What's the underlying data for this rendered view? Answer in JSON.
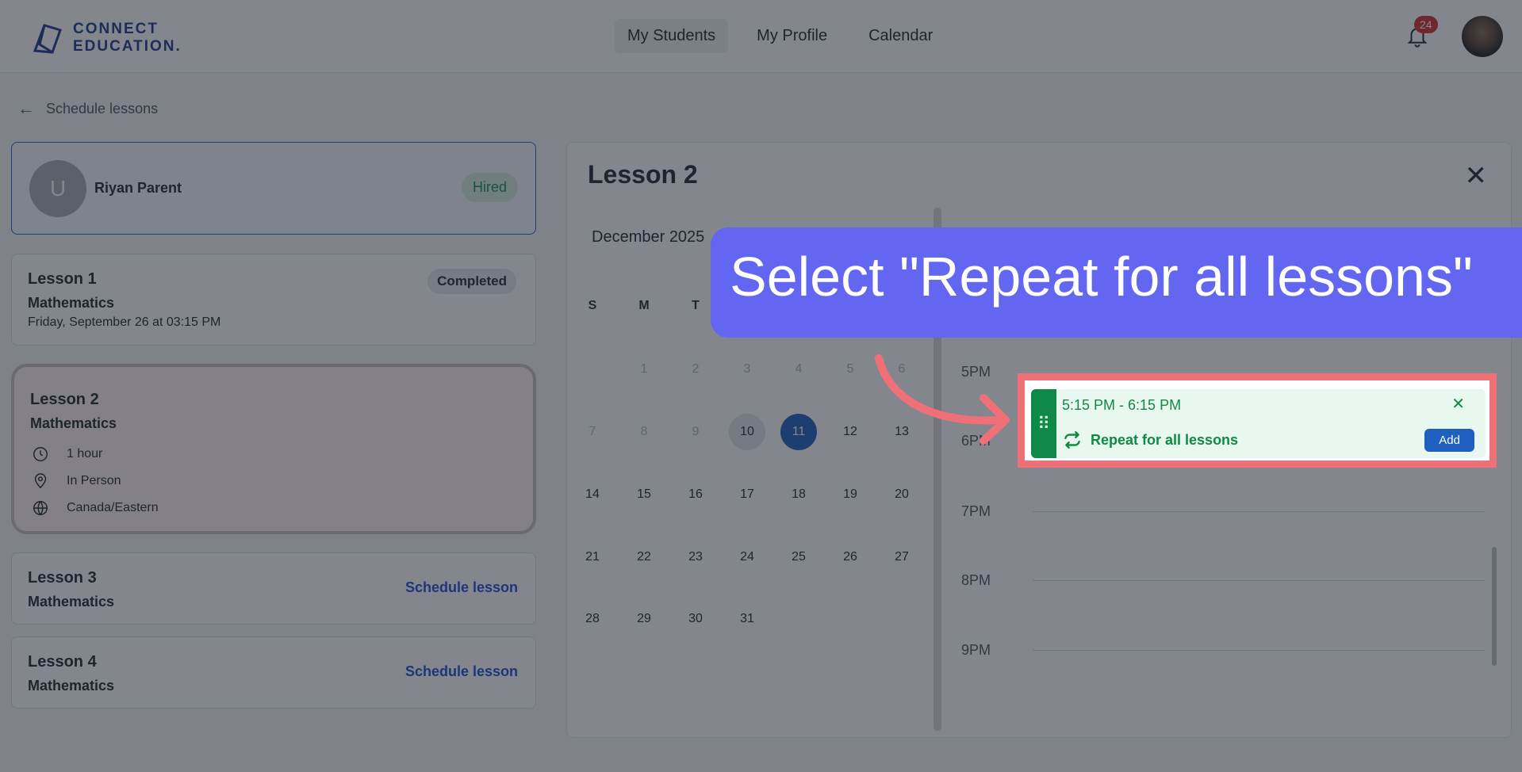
{
  "header": {
    "logo_line1": "CONNECT",
    "logo_line2": "EDUCATION.",
    "nav": [
      "My Students",
      "My Profile",
      "Calendar"
    ],
    "notification_count": "24"
  },
  "breadcrumb": {
    "back_label": "Schedule lessons"
  },
  "student": {
    "initial": "U",
    "name": "Riyan Parent",
    "status": "Hired"
  },
  "lessons": [
    {
      "title": "Lesson 1",
      "subject": "Mathematics",
      "date": "Friday, September 26 at 03:15 PM",
      "status": "Completed"
    },
    {
      "title": "Lesson 2",
      "subject": "Mathematics",
      "duration": "1 hour",
      "location": "In Person",
      "timezone": "Canada/Eastern"
    },
    {
      "title": "Lesson 3",
      "subject": "Mathematics",
      "action": "Schedule lesson"
    },
    {
      "title": "Lesson 4",
      "subject": "Mathematics",
      "action": "Schedule lesson"
    }
  ],
  "panel": {
    "title": "Lesson 2",
    "month": "December 2025",
    "weekdays": [
      "S",
      "M",
      "T"
    ],
    "calendar_days": [
      "1",
      "2",
      "3",
      "4",
      "5",
      "6",
      "7",
      "8",
      "9",
      "10",
      "11",
      "12",
      "13",
      "14",
      "15",
      "16",
      "17",
      "18",
      "19",
      "20",
      "21",
      "22",
      "23",
      "24",
      "25",
      "26",
      "27",
      "28",
      "29",
      "30",
      "31"
    ],
    "today": "10",
    "selected": "11",
    "time_labels": [
      "5PM",
      "6PM",
      "7PM",
      "8PM",
      "9PM"
    ]
  },
  "slot": {
    "time_range": "5:15 PM - 6:15 PM",
    "repeat_label": "Repeat for all lessons",
    "add_label": "Add",
    "close_symbol": "✕"
  },
  "tooltip": {
    "text": "Select \"Repeat for all lessons\""
  },
  "colors": {
    "accent": "#6366f1",
    "slot_green": "#0f8a46",
    "highlight": "#f07078",
    "primary": "#1f5fbf"
  }
}
